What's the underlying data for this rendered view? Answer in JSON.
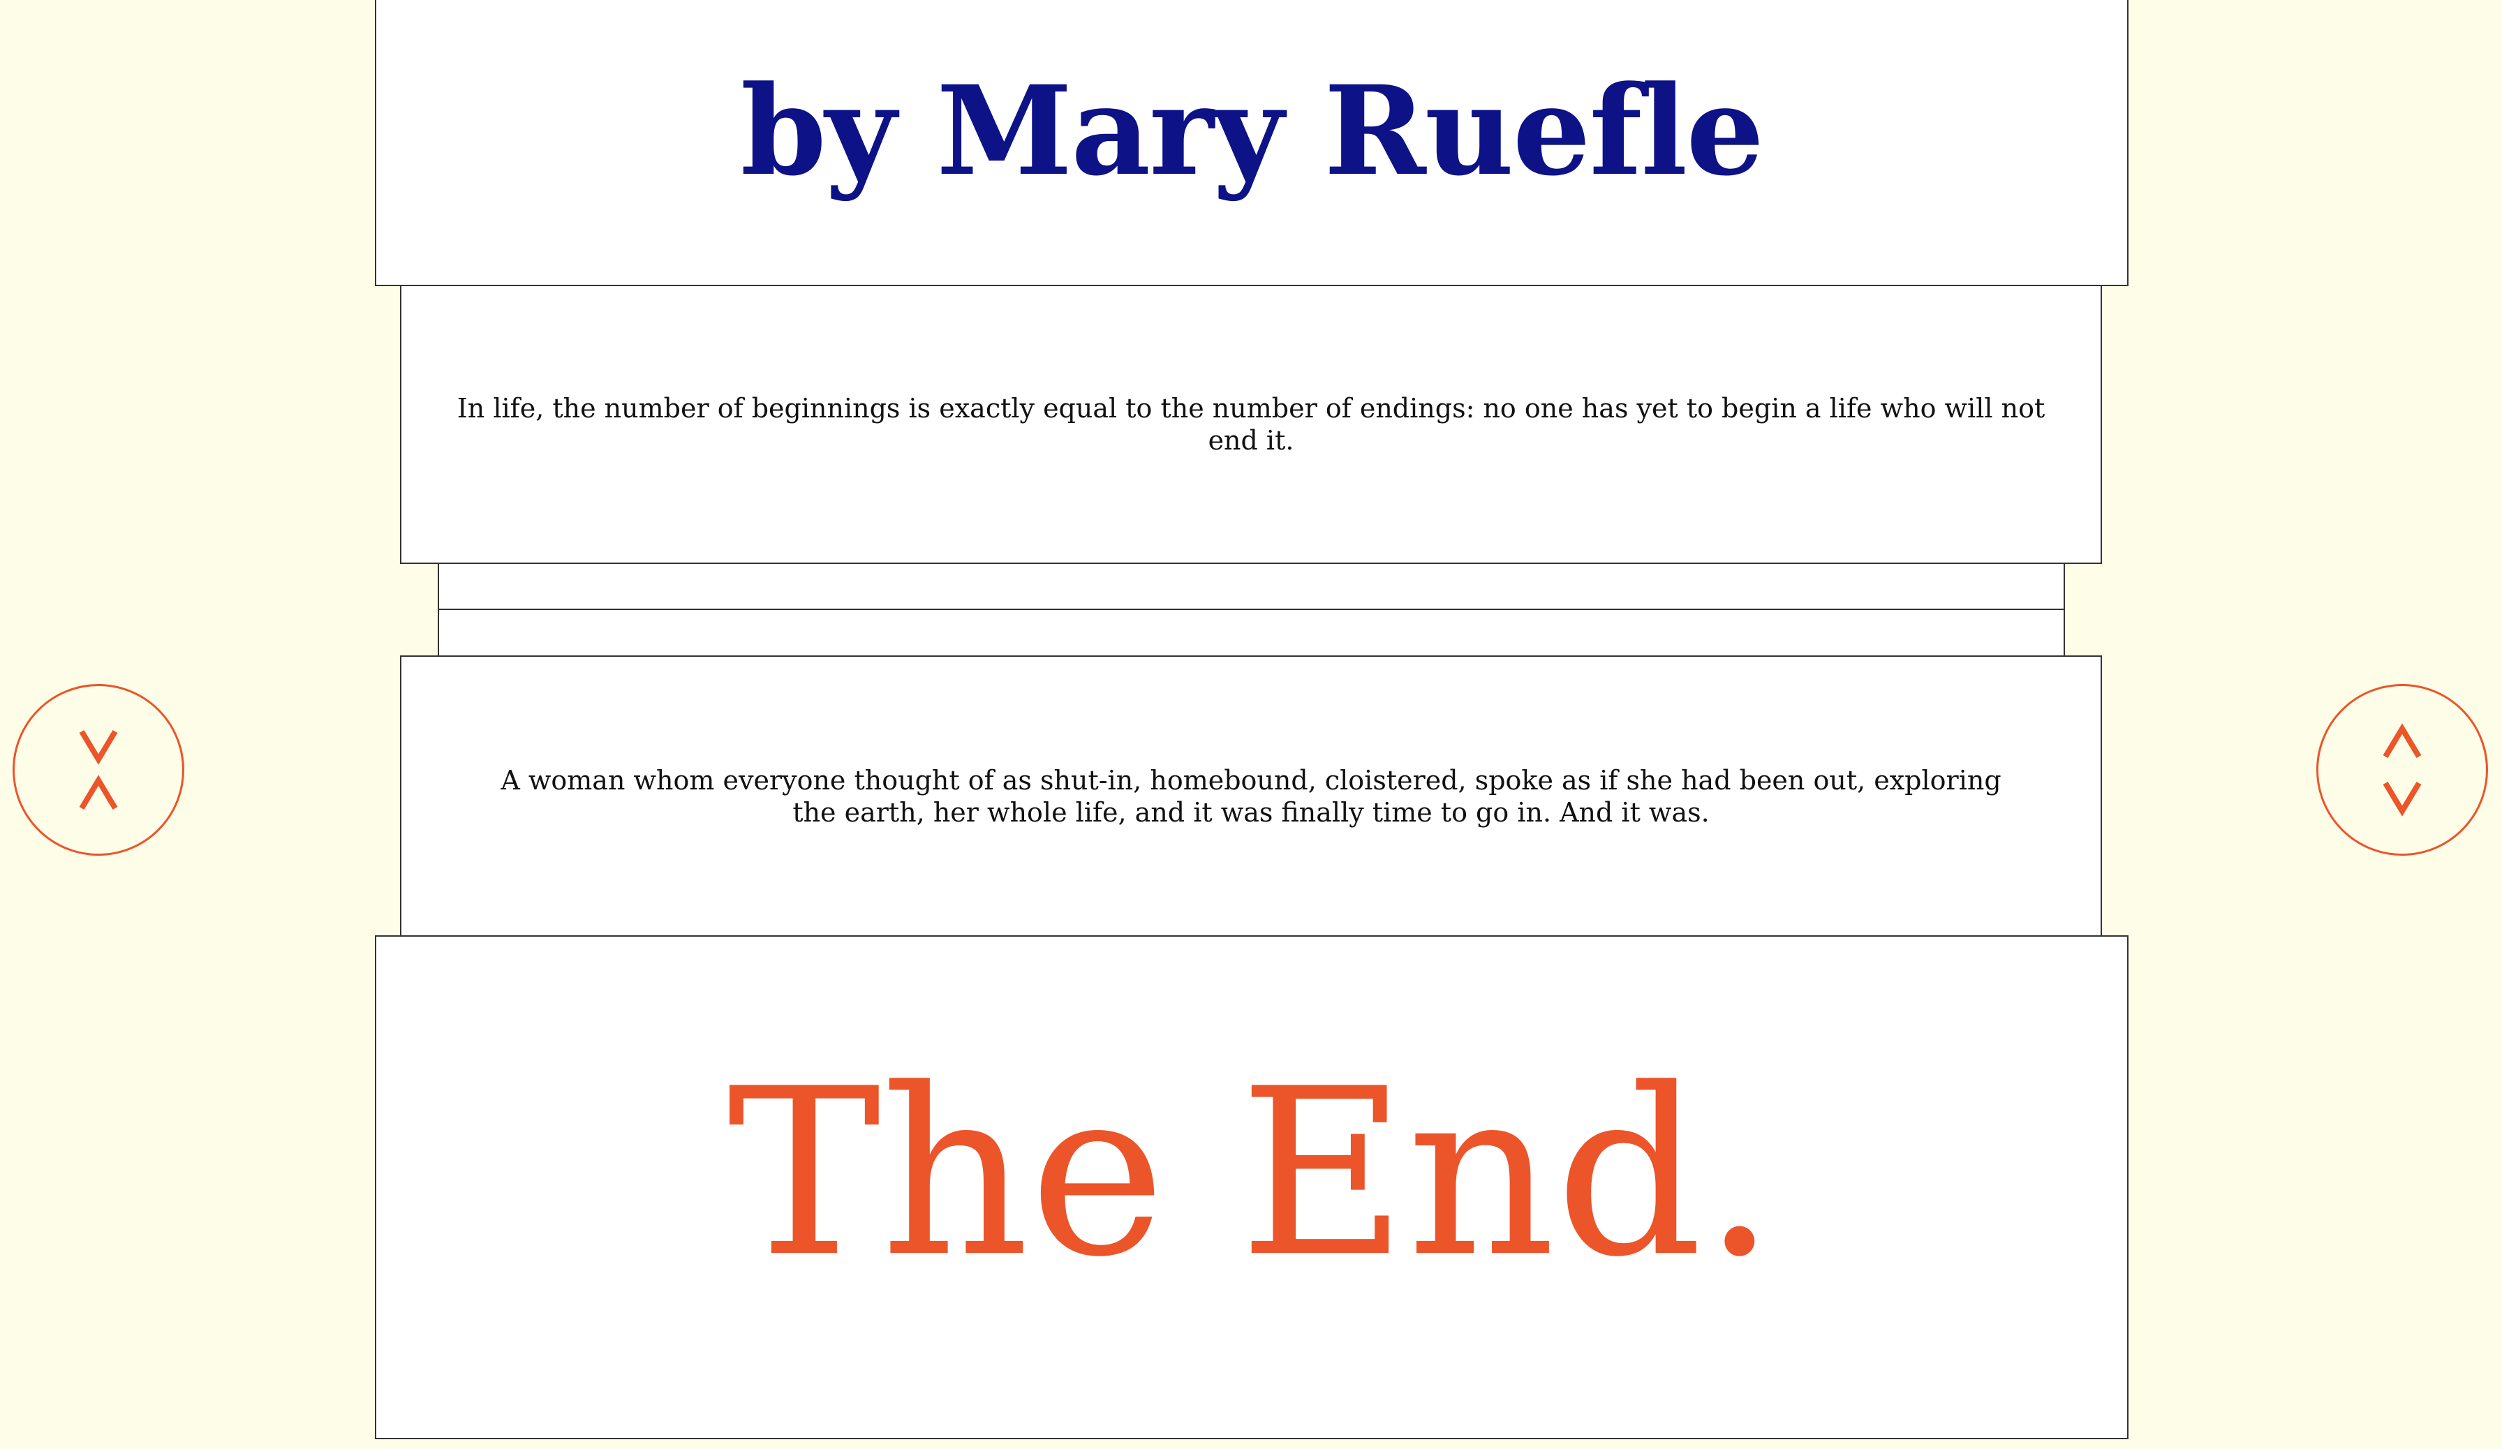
{
  "title_card": {
    "text": "by Mary Ruefle"
  },
  "quotes": [
    {
      "text": "In life, the number of beginnings is exactly equal to the number of endings: no one has yet to begin a life who will not end it."
    },
    {
      "text": "A woman whom everyone thought of as shut-in, homebound, cloistered, spoke as if she had been out, exploring the earth, her whole life, and it was finally time to go in. And it was."
    }
  ],
  "end_card": {
    "text": "The End."
  },
  "nav": {
    "left": {
      "icons": [
        "chevron-down-icon",
        "chevron-up-icon"
      ]
    },
    "right": {
      "icons": [
        "chevron-up-icon",
        "chevron-down-icon"
      ]
    }
  },
  "colors": {
    "background": "#fdfde8",
    "title": "#0d1287",
    "accent": "#ec542a",
    "border": "#333333"
  }
}
